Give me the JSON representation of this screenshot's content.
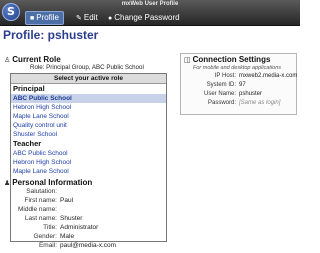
{
  "app": {
    "window_title": "mxWeb User Profile",
    "nav": [
      {
        "label": "Profile",
        "icon": "person-icon"
      },
      {
        "label": "Edit",
        "icon": "edit-icon"
      },
      {
        "label": "Change Password",
        "icon": "key-icon"
      }
    ]
  },
  "page": {
    "title": "Profile: pshuster"
  },
  "current_role": {
    "heading": "Current Role",
    "role_text": "Role: Principal Group, ABC Public School",
    "list_header": "Select your active role",
    "groups": [
      {
        "name": "Principal",
        "items": [
          {
            "label": "ABC Public School",
            "selected": true
          },
          {
            "label": "Hebron High School",
            "selected": false
          },
          {
            "label": "Maple Lane School",
            "selected": false
          },
          {
            "label": "Quality control unit",
            "selected": false
          },
          {
            "label": "Shuster School",
            "selected": false
          }
        ]
      },
      {
        "name": "Teacher",
        "items": [
          {
            "label": "ABC Public School",
            "selected": false
          },
          {
            "label": "Hebron High School",
            "selected": false
          },
          {
            "label": "Maple Lane School",
            "selected": false
          }
        ]
      }
    ]
  },
  "connection_settings": {
    "heading": "Connection Settings",
    "subtitle": "For mobile and desktop applications",
    "rows": [
      {
        "label": "IP Host:",
        "value": "mxweb2.media-x.com",
        "muted": false
      },
      {
        "label": "System ID:",
        "value": "97",
        "muted": false
      },
      {
        "label": "User Name:",
        "value": "pshuster",
        "muted": false
      },
      {
        "label": "Password:",
        "value": "[Same as login]",
        "muted": true
      }
    ]
  },
  "personal_info": {
    "heading": "Personal Information",
    "rows": [
      {
        "label": "Salutation:",
        "value": ""
      },
      {
        "label": "First name:",
        "value": "Paul"
      },
      {
        "label": "Middle name:",
        "value": ""
      },
      {
        "label": "Last name:",
        "value": "Shuster"
      },
      {
        "label": "Title:",
        "value": "Administrator"
      },
      {
        "label": "Gender:",
        "value": "Male"
      },
      {
        "label": "Email:",
        "value": "paul@media-x.com"
      }
    ]
  }
}
